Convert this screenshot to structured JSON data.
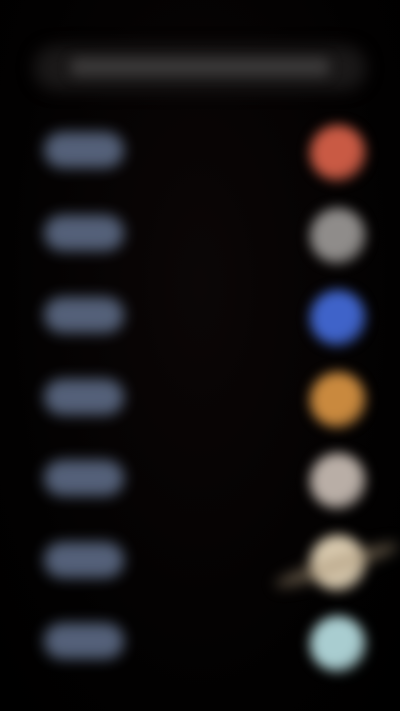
{
  "header": {
    "title": ""
  },
  "planets": [
    {
      "label": "",
      "icon": "mercury-icon",
      "color": "#c95a44"
    },
    {
      "label": "",
      "icon": "venus-icon",
      "color": "#8f8c8a"
    },
    {
      "label": "",
      "icon": "earth-icon",
      "color": "#3f63c9"
    },
    {
      "label": "",
      "icon": "mars-icon",
      "color": "#c9893e"
    },
    {
      "label": "",
      "icon": "jupiter-icon",
      "color": "#b9aea6"
    },
    {
      "label": "",
      "icon": "saturn-icon",
      "color": "#d8c9ae"
    },
    {
      "label": "",
      "icon": "uranus-icon",
      "color": "#a9cdd0"
    }
  ]
}
